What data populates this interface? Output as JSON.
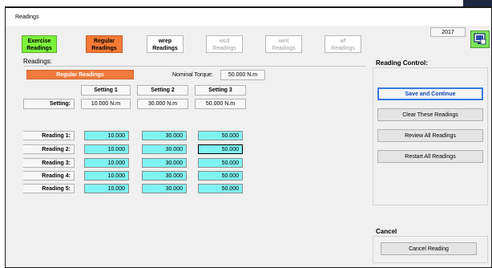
{
  "window": {
    "title": "Readings"
  },
  "tabs": [
    {
      "line1": "Exercise",
      "line2": "Readings",
      "style": "green"
    },
    {
      "line1": "Regular",
      "line2": "Readings",
      "style": "orange"
    },
    {
      "line1": "wrep",
      "line2": "Readings",
      "style": "active"
    },
    {
      "line1": "wcd",
      "line2": "Readings",
      "style": "disabled"
    },
    {
      "line1": "wint",
      "line2": "Readings",
      "style": "disabled"
    },
    {
      "line1": "wf",
      "line2": "Readings",
      "style": "disabled"
    }
  ],
  "year": "2017",
  "readings": {
    "section_label": "Readings:",
    "banner": "Regular Readings",
    "nominal_torque_label": "Nominal Torque:",
    "nominal_torque_value": "50.000 N.m",
    "setting_headers": [
      "Setting 1",
      "Setting 2",
      "Setting 3"
    ],
    "setting_label": "Setting:",
    "setting_values": [
      "10.000 N.m",
      "30.000 N.m",
      "50.000 N.m"
    ],
    "rows": [
      {
        "label": "Reading 1:",
        "values": [
          "10.000",
          "30.000",
          "50.000"
        ]
      },
      {
        "label": "Reading 2:",
        "values": [
          "10.000",
          "30.000",
          "50.000"
        ]
      },
      {
        "label": "Reading 3:",
        "values": [
          "10.000",
          "30.000",
          "50.000"
        ]
      },
      {
        "label": "Reading 4:",
        "values": [
          "10.000",
          "30.000",
          "50.000"
        ]
      },
      {
        "label": "Reading 5:",
        "values": [
          "10.000",
          "30.000",
          "50.000"
        ]
      }
    ]
  },
  "control": {
    "section_label": "Reading Control:",
    "save": "Save and Continue",
    "clear": "Clear These Readings",
    "review": "Review All Readings",
    "restart": "Restart All Readings"
  },
  "cancel": {
    "section_label": "Cancel",
    "button": "Cancel Reading"
  },
  "colors": {
    "exercise_tab": "#7cf23a",
    "regular_tab": "#f57a36",
    "reading_cell": "#7ff3f1",
    "primary_border": "#3a7be0"
  },
  "icons": {
    "top_right_button": "monitor-icon"
  }
}
